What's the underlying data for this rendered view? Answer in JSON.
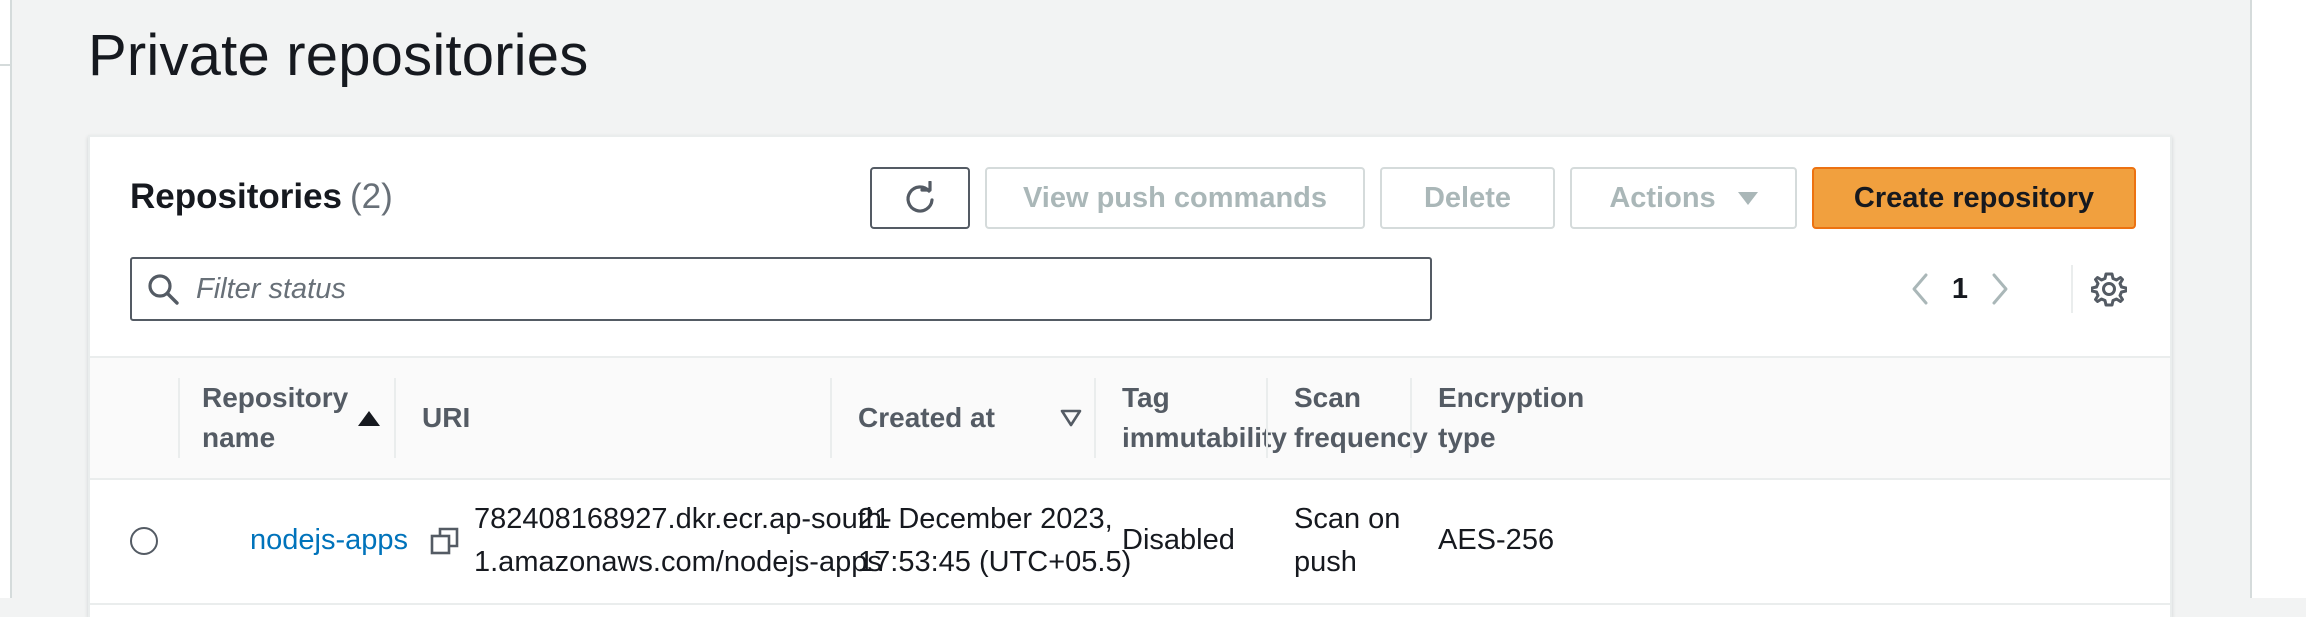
{
  "page": {
    "title": "Private repositories"
  },
  "panel": {
    "title": "Repositories",
    "count": "(2)",
    "buttons": {
      "refresh_icon": "refresh-icon",
      "view_push_commands": "View push commands",
      "delete": "Delete",
      "actions": "Actions",
      "create_repository": "Create repository"
    },
    "filter": {
      "placeholder": "Filter status",
      "value": ""
    },
    "pagination": {
      "current_page": "1"
    }
  },
  "table": {
    "columns": [
      {
        "label_line1": "Repository",
        "label_line2": "name",
        "sort": "ascending"
      },
      {
        "label": "URI"
      },
      {
        "label": "Created at",
        "sort": "sortable"
      },
      {
        "label_line1": "Tag",
        "label_line2": "immutability"
      },
      {
        "label_line1": "Scan",
        "label_line2": "frequency"
      },
      {
        "label_line1": "Encryption",
        "label_line2": "type"
      }
    ],
    "rows": [
      {
        "name": "nodejs-apps",
        "uri_line1": "782408168927.dkr.ecr.ap-south-",
        "uri_line2": "1.amazonaws.com/nodejs-apps",
        "created_line1": "21 December 2023,",
        "created_line2": "17:53:45 (UTC+05.5)",
        "tag_immutability": "Disabled",
        "scan_line1": "Scan on",
        "scan_line2": "push",
        "encryption": "AES-256"
      }
    ]
  },
  "colors": {
    "primary_button": "#f1a03e",
    "link": "#0073bb",
    "disabled_text": "#aab7b8"
  }
}
